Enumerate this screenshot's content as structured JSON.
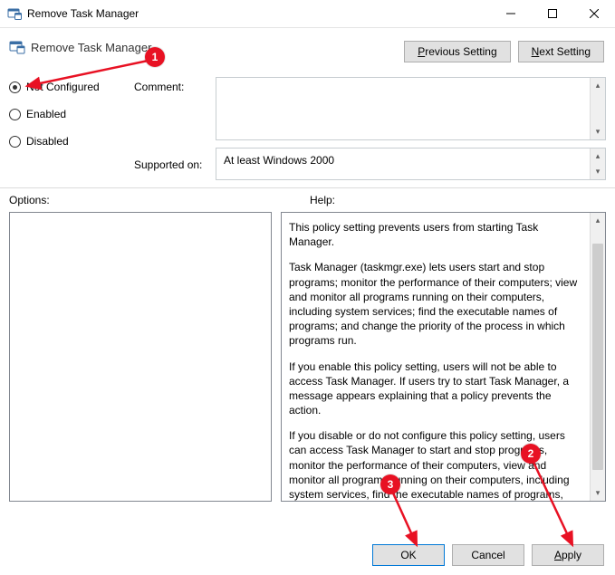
{
  "window": {
    "title": "Remove Task Manager"
  },
  "header": {
    "policy_name": "Remove Task Manager",
    "prev_setting": "Previous Setting",
    "next_setting": "Next Setting"
  },
  "state": {
    "options": [
      "Not Configured",
      "Enabled",
      "Disabled"
    ],
    "selected_index": 0
  },
  "labels": {
    "comment": "Comment:",
    "supported_on": "Supported on:",
    "options": "Options:",
    "help": "Help:"
  },
  "fields": {
    "comment_value": "",
    "supported_on_value": "At least Windows 2000"
  },
  "help": {
    "p1": "This policy setting prevents users from starting Task Manager.",
    "p2": "Task Manager (taskmgr.exe) lets users start and stop programs; monitor the performance of their computers; view and monitor all programs running on their computers, including system services; find the executable names of programs; and change the priority of the process in which programs run.",
    "p3": "If you enable this policy setting, users will not be able to access Task Manager. If users try to start Task Manager, a message appears explaining that a policy prevents the action.",
    "p4": "If you disable or do not configure this policy setting, users can access Task Manager to  start and stop programs, monitor the performance of their computers, view and monitor all programs running on their computers, including system services, find the executable names of programs, and change the priority of the process in which programs run."
  },
  "footer": {
    "ok": "OK",
    "cancel": "Cancel",
    "apply": "Apply"
  },
  "annotations": {
    "m1": "1",
    "m2": "2",
    "m3": "3"
  }
}
